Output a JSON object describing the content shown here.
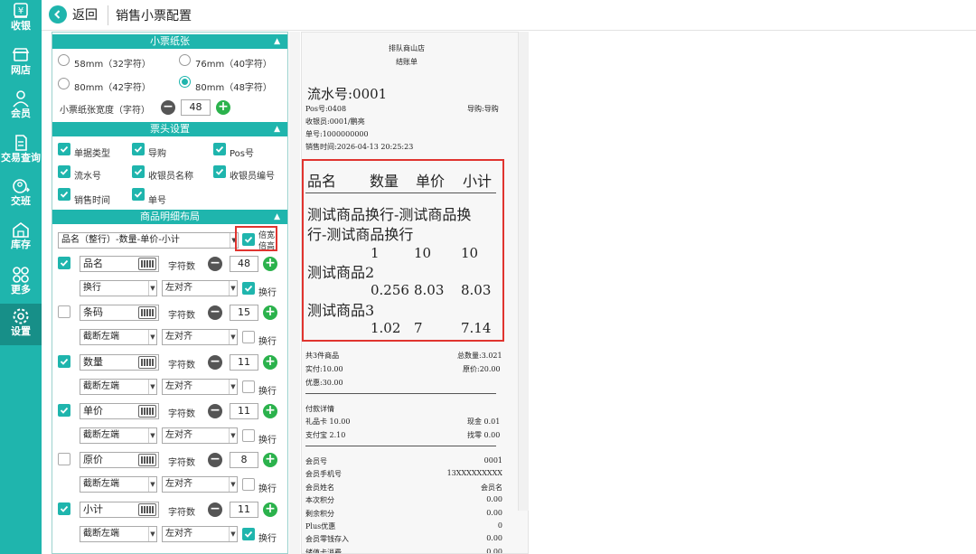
{
  "sidebar": {
    "items": [
      {
        "label": "收银",
        "icon": "cash-register-icon"
      },
      {
        "label": "网店",
        "icon": "store-icon"
      },
      {
        "label": "会员",
        "icon": "member-icon"
      },
      {
        "label": "交易查询",
        "icon": "transaction-query-icon"
      },
      {
        "label": "交班",
        "icon": "shift-handover-icon"
      },
      {
        "label": "库存",
        "icon": "inventory-icon"
      },
      {
        "label": "更多",
        "icon": "more-icon"
      },
      {
        "label": "设置",
        "icon": "settings-icon"
      }
    ],
    "active": "设置"
  },
  "header": {
    "back_label": "返回",
    "title": "销售小票配置"
  },
  "paper": {
    "title": "小票纸张",
    "options": [
      {
        "label": "58mm（32字符）",
        "selected": false
      },
      {
        "label": "76mm（40字符）",
        "selected": false
      },
      {
        "label": "80mm（42字符）",
        "selected": false
      },
      {
        "label": "80mm（48字符）",
        "selected": true
      }
    ],
    "width_label": "小票纸张宽度（字符）",
    "width_value": "48"
  },
  "header_settings": {
    "title": "票头设置",
    "items": [
      {
        "label": "单据类型",
        "checked": true
      },
      {
        "label": "导购",
        "checked": true
      },
      {
        "label": "Pos号",
        "checked": true
      },
      {
        "label": "流水号",
        "checked": true
      },
      {
        "label": "收银员名称",
        "checked": true
      },
      {
        "label": "收银员编号",
        "checked": true
      },
      {
        "label": "销售时间",
        "checked": true
      },
      {
        "label": "单号",
        "checked": true
      }
    ]
  },
  "detail_layout": {
    "title": "商品明细布局",
    "layout_select": "品名（整行）-数量-单价-小计",
    "double_width_label_1": "倍宽",
    "double_width_label_2": "倍高",
    "char_count_label": "字符数",
    "wrap_label": "换行",
    "fields": [
      {
        "name": "品名",
        "enabled": true,
        "chars": "48",
        "overflow": "换行",
        "align": "左对齐",
        "wrap": true
      },
      {
        "name": "条码",
        "enabled": false,
        "chars": "15",
        "overflow": "截断左端",
        "align": "左对齐",
        "wrap": false
      },
      {
        "name": "数量",
        "enabled": true,
        "chars": "11",
        "overflow": "截断左端",
        "align": "左对齐",
        "wrap": false
      },
      {
        "name": "单价",
        "enabled": true,
        "chars": "11",
        "overflow": "截断左端",
        "align": "左对齐",
        "wrap": false
      },
      {
        "name": "原价",
        "enabled": false,
        "chars": "8",
        "overflow": "截断左端",
        "align": "左对齐",
        "wrap": false
      },
      {
        "name": "小计",
        "enabled": true,
        "chars": "11",
        "overflow": "截断左端",
        "align": "左对齐",
        "wrap": true
      }
    ]
  },
  "receipt": {
    "store": "排队商山店",
    "doc_type": "结账单",
    "serial": "流水号:0001",
    "pos": "Pos号:0408",
    "guide": "导购:导购",
    "cashier": "收银员:0001/鹏亮",
    "order_no": "单号:1000000000",
    "sale_time": "销售时间:2026-04-13 20:25:23",
    "col_name": "品名",
    "col_qty": "数量",
    "col_price": "单价",
    "col_subtotal": "小计",
    "item1_name_line1": "测试商品换行-测试商品换",
    "item1_name_line2": "行-测试商品换行",
    "item1_qty": "1",
    "item1_price": "10",
    "item1_subtotal": "10",
    "item2_name": "测试商品2",
    "item2_qty": "0.256",
    "item2_price": "8.03",
    "item2_subtotal": "8.03",
    "item3_name": "测试商品3",
    "item3_qty": "1.02",
    "item3_price": "7",
    "item3_subtotal": "7.14",
    "total_items": "共3件商品",
    "total_qty": "总数量:3.021",
    "paid": "实付:10.00",
    "original": "原价:20.00",
    "discount": "优惠:30.00",
    "pay_title": "付款详情",
    "gift_card": "礼品卡 10.00",
    "cash": "现金 0.01",
    "alipay": "支付宝 2.10",
    "change": "找零 0.00",
    "member_no_label": "会员号",
    "member_no": "0001",
    "member_phone_label": "会员手机号",
    "member_phone": "13XXXXXXXXX",
    "member_name_label": "会员姓名",
    "member_name": "会员名",
    "points_label": "本次积分",
    "points": "0.00",
    "remain_points_label": "剩余积分",
    "remain_points": "0.00",
    "plus_label": "Plus优惠",
    "plus": "0",
    "change_deposit_label": "会员零钱存入",
    "change_deposit": "0.00",
    "last_label": "储值卡消费",
    "last": "0.00"
  }
}
